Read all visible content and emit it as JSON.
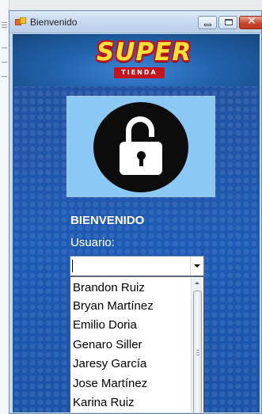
{
  "window": {
    "title": "Bienvenido",
    "close_glyph": "✕"
  },
  "brand": {
    "logo_main": "SUPER",
    "logo_sub": "TIENDA",
    "colors": {
      "logo_yellow": "#ffe13a",
      "logo_red": "#c0141f",
      "background_blue": "#1f54a8"
    }
  },
  "icons": [
    "app-icon",
    "lock-icon",
    "chevron-down-icon",
    "scroll-up-icon"
  ],
  "login": {
    "heading": "BIENVENIDO",
    "user_label": "Usuario:",
    "user_value": "",
    "users": [
      "Brandon Ruiz",
      "Bryan Martínez",
      "Emilio Doria",
      "Genaro Siller",
      "Jaresy García",
      "Jose Martínez",
      "Karina Ruiz"
    ]
  }
}
